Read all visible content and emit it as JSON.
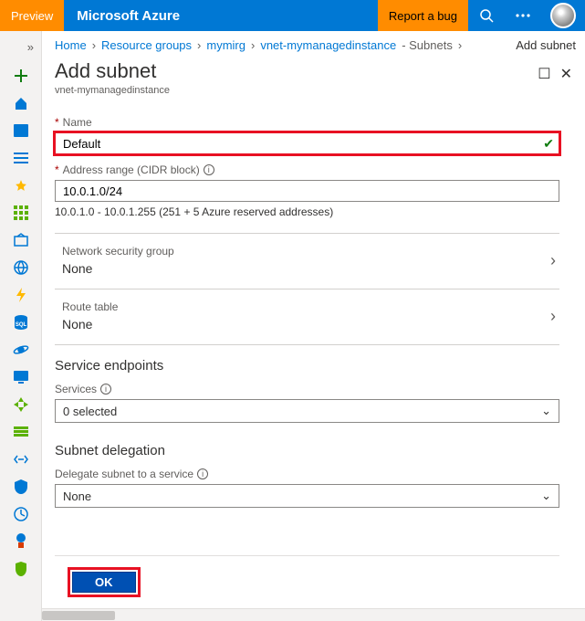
{
  "topbar": {
    "preview": "Preview",
    "brand": "Microsoft Azure",
    "report_bug": "Report a bug"
  },
  "breadcrumbs": {
    "home": "Home",
    "resource_groups": "Resource groups",
    "rg_name": "mymirg",
    "vnet_name": "vnet-mymanagedinstance",
    "subnets": "- Subnets",
    "current": "Add subnet"
  },
  "panel": {
    "title": "Add subnet",
    "subtitle": "vnet-mymanagedinstance"
  },
  "form": {
    "name_label": "Name",
    "name_value": "Default",
    "cidr_label": "Address range (CIDR block)",
    "cidr_value": "10.0.1.0/24",
    "cidr_hint": "10.0.1.0 - 10.0.1.255 (251 + 5 Azure reserved addresses)",
    "nsg_label": "Network security group",
    "nsg_value": "None",
    "route_label": "Route table",
    "route_value": "None",
    "endpoints_title": "Service endpoints",
    "services_label": "Services",
    "services_value": "0 selected",
    "delegation_title": "Subnet delegation",
    "delegation_label": "Delegate subnet to a service",
    "delegation_value": "None",
    "ok": "OK"
  }
}
